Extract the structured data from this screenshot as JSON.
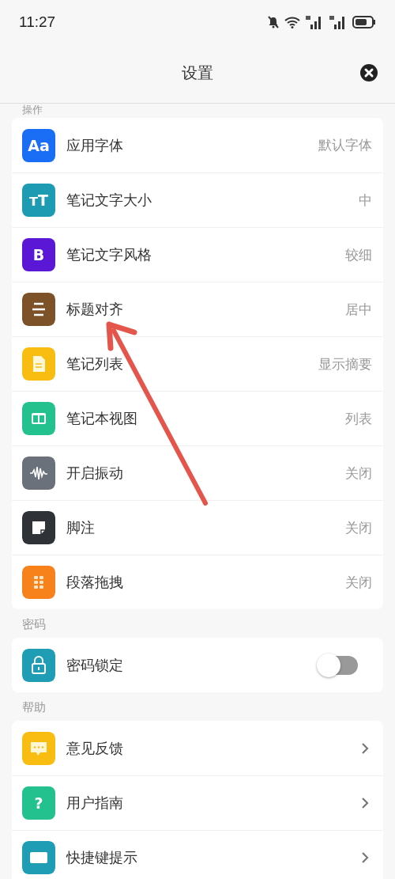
{
  "status_bar": {
    "time": "11:27"
  },
  "header": {
    "title": "设置"
  },
  "sections": [
    {
      "label": "操作",
      "items": [
        {
          "kind": "value",
          "label": "应用字体",
          "value": "默认字体",
          "color": "#1a6ef5",
          "icon_text": "Aa"
        },
        {
          "kind": "value",
          "label": "笔记文字大小",
          "value": "中",
          "color": "#1c9bb3",
          "icon_text": "ᴛT"
        },
        {
          "kind": "value",
          "label": "笔记文字风格",
          "value": "较细",
          "color": "#5a17d6",
          "icon_text": "B"
        },
        {
          "kind": "value",
          "label": "标题对齐",
          "value": "居中",
          "color": "#7d5228"
        },
        {
          "kind": "value",
          "label": "笔记列表",
          "value": "显示摘要",
          "color": "#f8bd10"
        },
        {
          "kind": "value",
          "label": "笔记本视图",
          "value": "列表",
          "color": "#22c18e"
        },
        {
          "kind": "value",
          "label": "开启振动",
          "value": "关闭",
          "color": "#6b717b"
        },
        {
          "kind": "value",
          "label": "脚注",
          "value": "关闭",
          "color": "#2f3237"
        },
        {
          "kind": "value",
          "label": "段落拖拽",
          "value": "关闭",
          "color": "#f7821b"
        }
      ]
    },
    {
      "label": "密码",
      "items": [
        {
          "kind": "toggle",
          "label": "密码锁定",
          "on": false,
          "color": "#1e9db5"
        }
      ]
    },
    {
      "label": "帮助",
      "items": [
        {
          "kind": "link",
          "label": "意见反馈",
          "color": "#f8bd10"
        },
        {
          "kind": "link",
          "label": "用户指南",
          "color": "#22c18e",
          "icon_text": "?"
        },
        {
          "kind": "link",
          "label": "快捷键提示",
          "color": "#1e9db5"
        }
      ]
    }
  ]
}
